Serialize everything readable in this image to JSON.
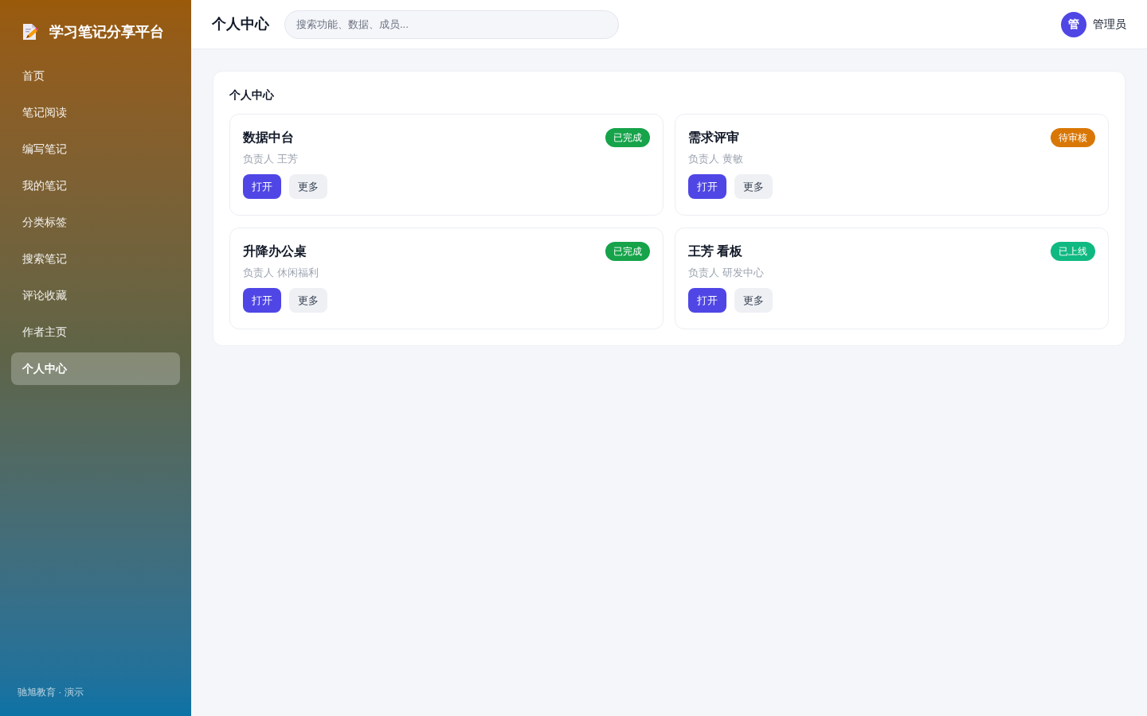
{
  "sidebar": {
    "brand": "学习笔记分享平台",
    "items": [
      {
        "label": "首页",
        "selected": false
      },
      {
        "label": "笔记阅读",
        "selected": false
      },
      {
        "label": "编写笔记",
        "selected": false
      },
      {
        "label": "我的笔记",
        "selected": false
      },
      {
        "label": "分类标签",
        "selected": false
      },
      {
        "label": "搜索笔记",
        "selected": false
      },
      {
        "label": "评论收藏",
        "selected": false
      },
      {
        "label": "作者主页",
        "selected": false
      },
      {
        "label": "个人中心",
        "selected": true
      }
    ],
    "footer": "驰旭教育 · 演示"
  },
  "header": {
    "title": "个人中心",
    "search": {
      "placeholder": "搜索功能、数据、成员..."
    },
    "user": {
      "avatar": "管",
      "name": "管理员"
    }
  },
  "panel": {
    "title": "个人中心",
    "cards": [
      {
        "title": "数据中台",
        "status": "已完成",
        "color": "#16a34a",
        "owner": "负责人 王芳",
        "actions": [
          {
            "label": "打开",
            "kind": "primary"
          },
          {
            "label": "更多",
            "kind": "secondary"
          }
        ]
      },
      {
        "title": "需求评审",
        "status": "待审核",
        "color": "#d97706",
        "owner": "负责人 黄敏",
        "actions": [
          {
            "label": "打开",
            "kind": "primary"
          },
          {
            "label": "更多",
            "kind": "secondary"
          }
        ]
      },
      {
        "title": "升降办公桌",
        "status": "已完成",
        "color": "#16a34a",
        "owner": "负责人 休闲福利",
        "actions": [
          {
            "label": "打开",
            "kind": "primary"
          },
          {
            "label": "更多",
            "kind": "secondary"
          }
        ]
      },
      {
        "title": "王芳 看板",
        "status": "已上线",
        "color": "#10b981",
        "owner": "负责人 研发中心",
        "actions": [
          {
            "label": "打开",
            "kind": "primary"
          },
          {
            "label": "更多",
            "kind": "secondary"
          }
        ]
      }
    ]
  }
}
